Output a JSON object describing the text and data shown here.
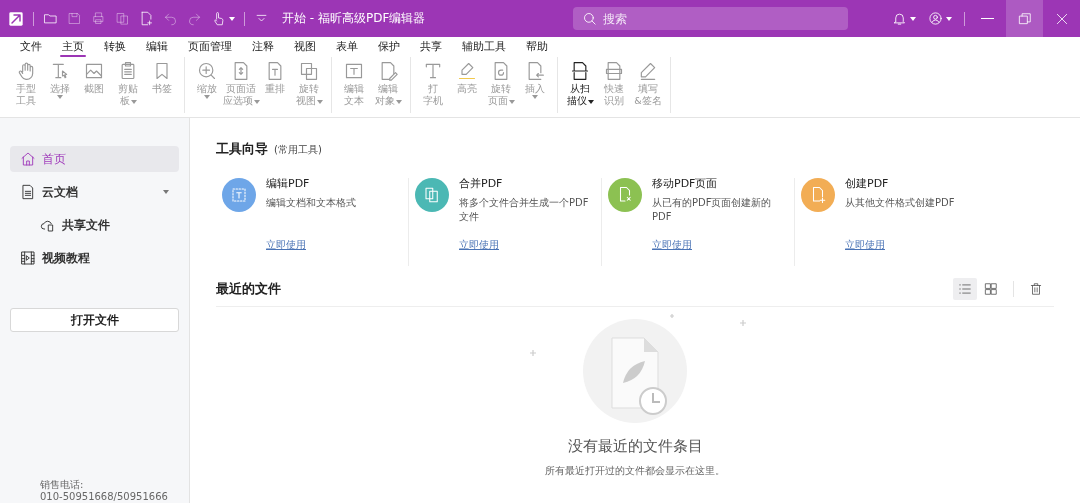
{
  "window": {
    "title": "开始 - 福昕高级PDF编辑器"
  },
  "search": {
    "placeholder": "搜索"
  },
  "menu": [
    {
      "label": "文件",
      "selected": false
    },
    {
      "label": "主页",
      "selected": true
    },
    {
      "label": "转换",
      "selected": false
    },
    {
      "label": "编辑",
      "selected": false
    },
    {
      "label": "页面管理",
      "selected": false
    },
    {
      "label": "注释",
      "selected": false
    },
    {
      "label": "视图",
      "selected": false
    },
    {
      "label": "表单",
      "selected": false
    },
    {
      "label": "保护",
      "selected": false
    },
    {
      "label": "共享",
      "selected": false
    },
    {
      "label": "辅助工具",
      "selected": false
    },
    {
      "label": "帮助",
      "selected": false
    }
  ],
  "ribbon": {
    "groups": [
      {
        "tools": [
          {
            "lines": [
              "手型",
              "工具"
            ],
            "dropdown": false,
            "disabled": true
          },
          {
            "lines": [
              "选择"
            ],
            "dropdown": true,
            "disabled": true
          },
          {
            "lines": [
              "截图"
            ],
            "dropdown": false,
            "disabled": true
          },
          {
            "lines": [
              "剪贴",
              "板"
            ],
            "dropdown": true,
            "disabled": true
          },
          {
            "lines": [
              "书签"
            ],
            "dropdown": false,
            "disabled": true
          }
        ]
      },
      {
        "tools": [
          {
            "lines": [
              "缩放"
            ],
            "dropdown": true,
            "disabled": true
          },
          {
            "lines": [
              "页面适",
              "应选项"
            ],
            "dropdown": true,
            "disabled": true
          },
          {
            "lines": [
              "重排"
            ],
            "dropdown": false,
            "disabled": true
          },
          {
            "lines": [
              "旋转",
              "视图"
            ],
            "dropdown": true,
            "disabled": true
          }
        ]
      },
      {
        "tools": [
          {
            "lines": [
              "编辑",
              "文本"
            ],
            "dropdown": false,
            "disabled": true
          },
          {
            "lines": [
              "编辑",
              "对象"
            ],
            "dropdown": true,
            "disabled": true
          }
        ]
      },
      {
        "tools": [
          {
            "lines": [
              "打",
              "字机"
            ],
            "dropdown": false,
            "disabled": true
          },
          {
            "lines": [
              "高亮"
            ],
            "dropdown": false,
            "disabled": true
          },
          {
            "lines": [
              "旋转",
              "页面"
            ],
            "dropdown": true,
            "disabled": true
          },
          {
            "lines": [
              "插入"
            ],
            "dropdown": true,
            "disabled": true
          }
        ]
      },
      {
        "tools": [
          {
            "lines": [
              "从扫",
              "描仪"
            ],
            "dropdown": true,
            "disabled": false
          },
          {
            "lines": [
              "快速",
              "识别"
            ],
            "dropdown": false,
            "disabled": true
          },
          {
            "lines": [
              "填写",
              "&签名"
            ],
            "dropdown": false,
            "disabled": true
          }
        ]
      }
    ]
  },
  "sidebar": {
    "items": [
      {
        "label": "首页",
        "selected": true
      },
      {
        "label": "云文档",
        "selected": false,
        "expanded": true,
        "children": [
          {
            "label": "共享文件",
            "selected": false
          }
        ]
      },
      {
        "label": "视频教程",
        "selected": false
      }
    ],
    "open_button": "打开文件",
    "phone_label": "销售电话:",
    "phone": "010-50951668/50951666"
  },
  "tool_guide": {
    "title": "工具向导",
    "subtitle": "(常用工具)",
    "cards": [
      {
        "title": "编辑PDF",
        "description": "编辑文档和文本格式",
        "link": "立即使用",
        "color": "#6ea6e8"
      },
      {
        "title": "合并PDF",
        "description": "将多个文件合并生成一个PDF文件",
        "link": "立即使用",
        "color": "#4bb8b4"
      },
      {
        "title": "移动PDF页面",
        "description": "从已有的PDF页面创建新的PDF",
        "link": "立即使用",
        "color": "#8cc152"
      },
      {
        "title": "创建PDF",
        "description": "从其他文件格式创建PDF",
        "link": "立即使用",
        "color": "#f2ad55"
      }
    ]
  },
  "recent": {
    "title": "最近的文件",
    "views": [
      {
        "selected": true
      },
      {
        "selected": false
      }
    ],
    "empty_title": "没有最近的文件条目",
    "empty_text": "所有最近打开过的文件都会显示在这里。"
  }
}
